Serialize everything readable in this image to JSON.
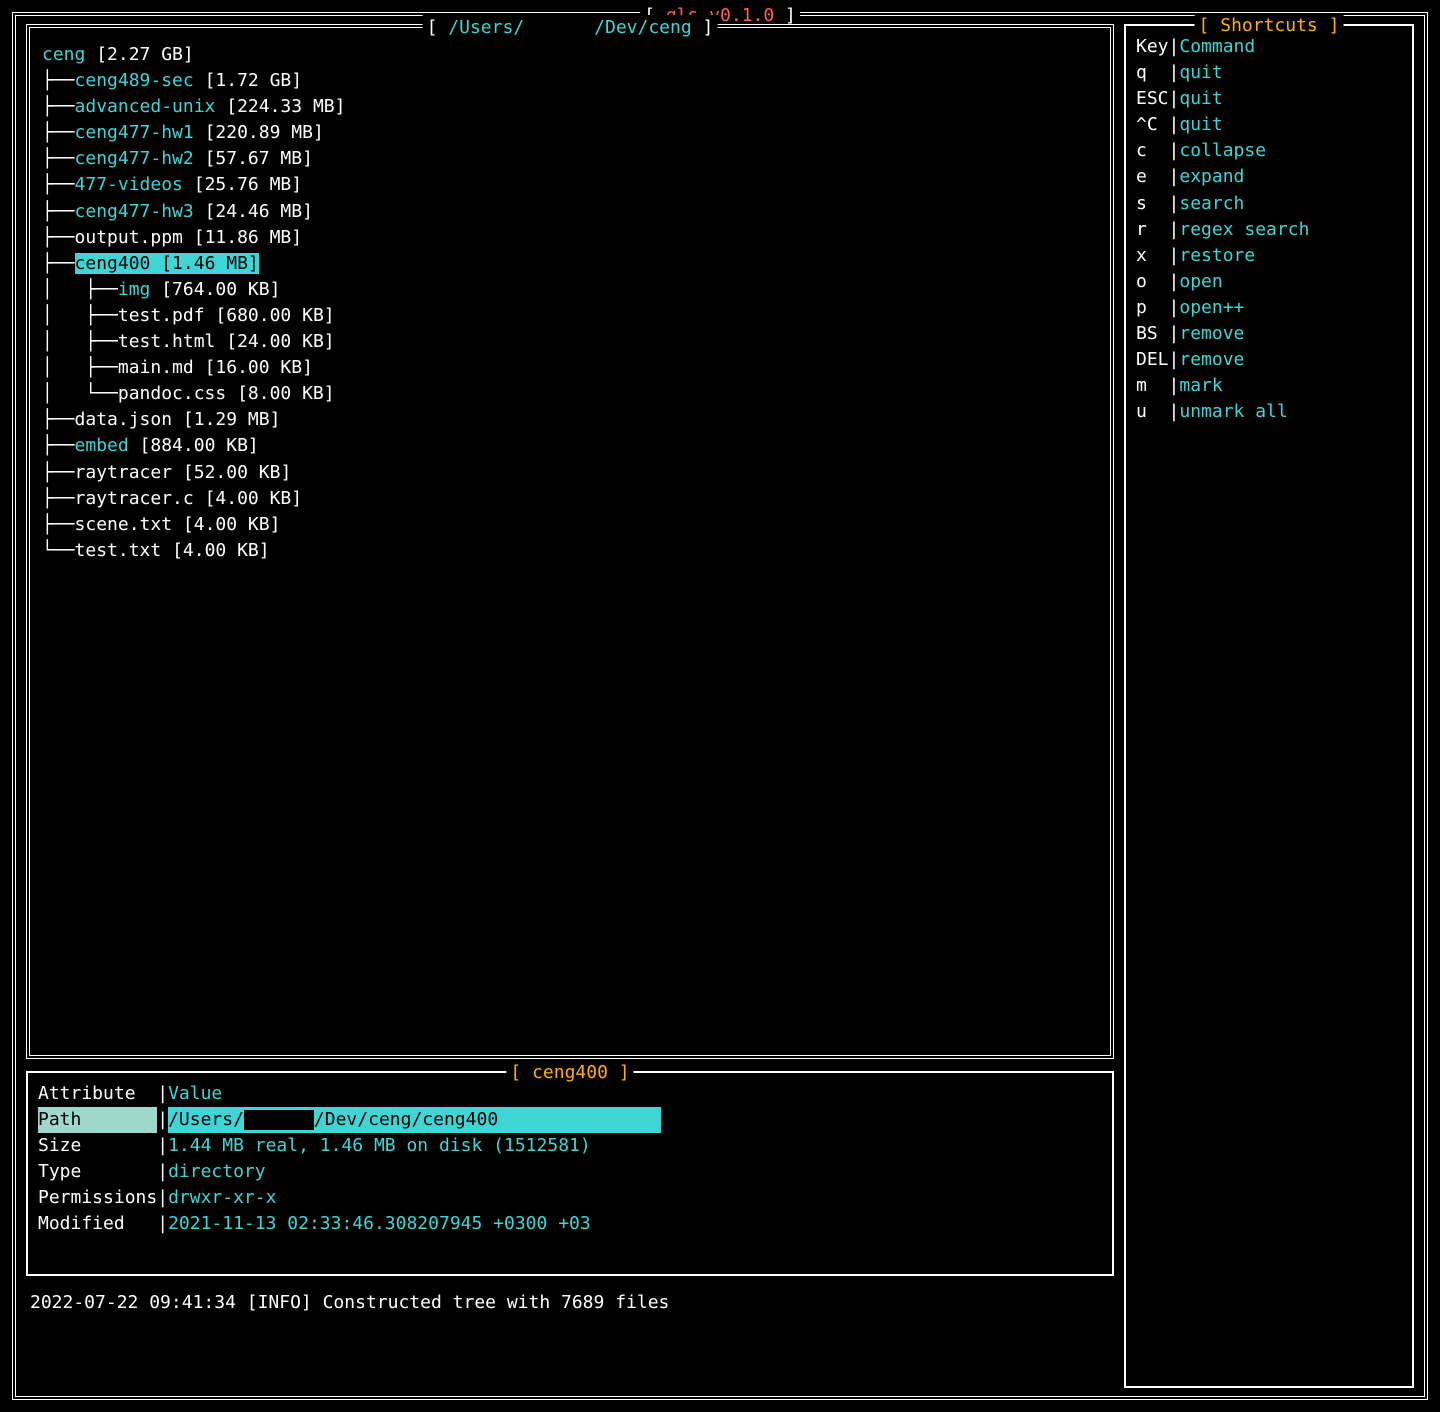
{
  "app": {
    "title_prefix": "[ ",
    "title": "gls v0.1.0",
    "title_suffix": " ]"
  },
  "tree": {
    "title_prefix": "[ ",
    "path_head": "/Users/",
    "path_tail": "/Dev/ceng",
    "title_suffix": " ]",
    "root": {
      "name": "ceng",
      "size": "[2.27 GB]"
    },
    "items": [
      {
        "depth": 1,
        "prefix": "├──",
        "name": "ceng489-sec",
        "size": "[1.72 GB]",
        "type": "dir"
      },
      {
        "depth": 1,
        "prefix": "├──",
        "name": "advanced-unix",
        "size": "[224.33 MB]",
        "type": "dir"
      },
      {
        "depth": 1,
        "prefix": "├──",
        "name": "ceng477-hw1",
        "size": "[220.89 MB]",
        "type": "dir"
      },
      {
        "depth": 1,
        "prefix": "├──",
        "name": "ceng477-hw2",
        "size": "[57.67 MB]",
        "type": "dir"
      },
      {
        "depth": 1,
        "prefix": "├──",
        "name": "477-videos",
        "size": "[25.76 MB]",
        "type": "dir"
      },
      {
        "depth": 1,
        "prefix": "├──",
        "name": "ceng477-hw3",
        "size": "[24.46 MB]",
        "type": "dir"
      },
      {
        "depth": 1,
        "prefix": "├──",
        "name": "output.ppm",
        "size": "[11.86 MB]",
        "type": "file"
      },
      {
        "depth": 1,
        "prefix": "├──",
        "name": "ceng400",
        "size": "[1.46 MB]",
        "type": "dir",
        "selected": true
      },
      {
        "depth": 2,
        "prefix": "│   ├──",
        "name": "img",
        "size": "[764.00 KB]",
        "type": "dir"
      },
      {
        "depth": 2,
        "prefix": "│   ├──",
        "name": "test.pdf",
        "size": "[680.00 KB]",
        "type": "file"
      },
      {
        "depth": 2,
        "prefix": "│   ├──",
        "name": "test.html",
        "size": "[24.00 KB]",
        "type": "file"
      },
      {
        "depth": 2,
        "prefix": "│   ├──",
        "name": "main.md",
        "size": "[16.00 KB]",
        "type": "file"
      },
      {
        "depth": 2,
        "prefix": "│   └──",
        "name": "pandoc.css",
        "size": "[8.00 KB]",
        "type": "file"
      },
      {
        "depth": 1,
        "prefix": "├──",
        "name": "data.json",
        "size": "[1.29 MB]",
        "type": "file"
      },
      {
        "depth": 1,
        "prefix": "├──",
        "name": "embed",
        "size": "[884.00 KB]",
        "type": "dir"
      },
      {
        "depth": 1,
        "prefix": "├──",
        "name": "raytracer",
        "size": "[52.00 KB]",
        "type": "file"
      },
      {
        "depth": 1,
        "prefix": "├──",
        "name": "raytracer.c",
        "size": "[4.00 KB]",
        "type": "file"
      },
      {
        "depth": 1,
        "prefix": "├──",
        "name": "scene.txt",
        "size": "[4.00 KB]",
        "type": "file"
      },
      {
        "depth": 1,
        "prefix": "└──",
        "name": "test.txt",
        "size": "[4.00 KB]",
        "type": "file"
      }
    ]
  },
  "detail": {
    "title": "[ ceng400 ]",
    "header_key": "Attribute  ",
    "header_val": "Value",
    "rows": [
      {
        "key": "Path       ",
        "val_head": "/Users/",
        "val_tail": "/Dev/ceng/ceng400",
        "highlight": true
      },
      {
        "key": "Size       ",
        "val": "1.44 MB real, 1.46 MB on disk (1512581)"
      },
      {
        "key": "Type       ",
        "val": "directory"
      },
      {
        "key": "Permissions",
        "val": "drwxr-xr-x"
      },
      {
        "key": "Modified   ",
        "val": "2021-11-13 02:33:46.308207945 +0300 +03"
      }
    ]
  },
  "shortcuts": {
    "title": "[ Shortcuts ]",
    "header_key": "Key",
    "header_val": "Command",
    "rows": [
      {
        "key": "q  ",
        "cmd": "quit"
      },
      {
        "key": "ESC",
        "cmd": "quit"
      },
      {
        "key": "^C ",
        "cmd": "quit"
      },
      {
        "key": "c  ",
        "cmd": "collapse"
      },
      {
        "key": "e  ",
        "cmd": "expand"
      },
      {
        "key": "s  ",
        "cmd": "search"
      },
      {
        "key": "r  ",
        "cmd": "regex search"
      },
      {
        "key": "x  ",
        "cmd": "restore"
      },
      {
        "key": "o  ",
        "cmd": "open"
      },
      {
        "key": "p  ",
        "cmd": "open++"
      },
      {
        "key": "BS ",
        "cmd": "remove"
      },
      {
        "key": "DEL",
        "cmd": "remove"
      },
      {
        "key": "m  ",
        "cmd": "mark"
      },
      {
        "key": "u  ",
        "cmd": "unmark all"
      }
    ]
  },
  "status": {
    "line": "2022-07-22 09:41:34 [INFO] Constructed tree with 7689 files"
  }
}
